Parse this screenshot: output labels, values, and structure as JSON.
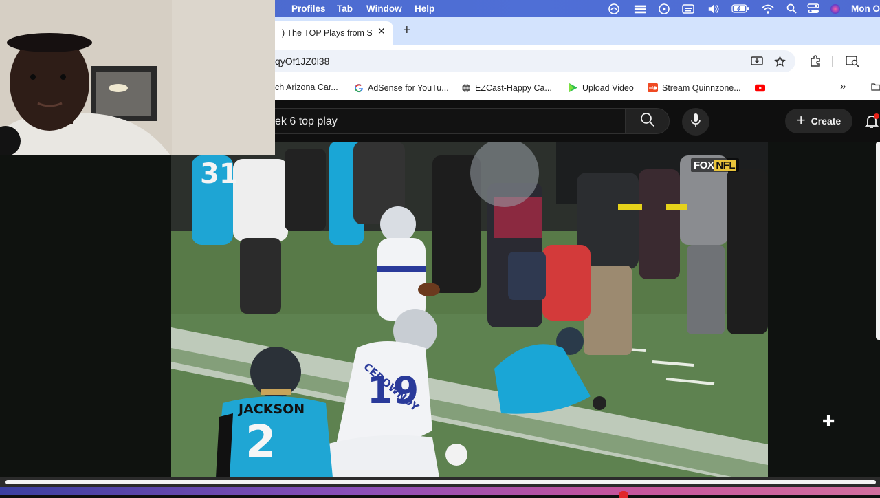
{
  "menubar": {
    "items": [
      "Profiles",
      "Tab",
      "Window",
      "Help"
    ],
    "clock": "Mon O",
    "status_icons": [
      "creative-cloud-icon",
      "stacks-icon",
      "play-circle-icon",
      "keyboard-icon",
      "volume-icon",
      "battery-icon",
      "wifi-icon",
      "spotlight-search-icon",
      "control-center-icon",
      "siri-icon"
    ]
  },
  "browser": {
    "tab_title": ") The TOP Plays from S",
    "tab_close": "✕",
    "new_tab": "+",
    "url": "qyOf1JZ0l38",
    "bookmarks": [
      {
        "label": "ch Arizona Car...",
        "icon": "none"
      },
      {
        "label": "AdSense for YouTu...",
        "icon": "google-icon"
      },
      {
        "label": "EZCast-Happy Ca...",
        "icon": "globe-icon"
      },
      {
        "label": "Upload Video",
        "icon": "upload-video-icon"
      },
      {
        "label": "Stream Quinnzone...",
        "icon": "soundcloud-icon"
      },
      {
        "label": "",
        "icon": "youtube-icon"
      }
    ],
    "more_bookmarks": "»"
  },
  "youtube": {
    "search_query": "ek 6 top play",
    "create_label": "Create",
    "create_plus": "+"
  },
  "video": {
    "network_fox": "FOX",
    "network_nfl": "NFL",
    "jersey_left_name": "JACKSON",
    "jersey_left_number": "2",
    "jersey_mid_name": "CEDOWNOY",
    "jersey_mid_number": "19",
    "jersey_back_number": "31",
    "cursor": "✚"
  },
  "colors": {
    "menubar": "#4f6fd6",
    "tabstrip": "#d3e3fd",
    "youtube_bg": "#0f0f0f",
    "panthers_blue": "#1aa6d6",
    "nfl_yellow": "#e8c33a"
  }
}
